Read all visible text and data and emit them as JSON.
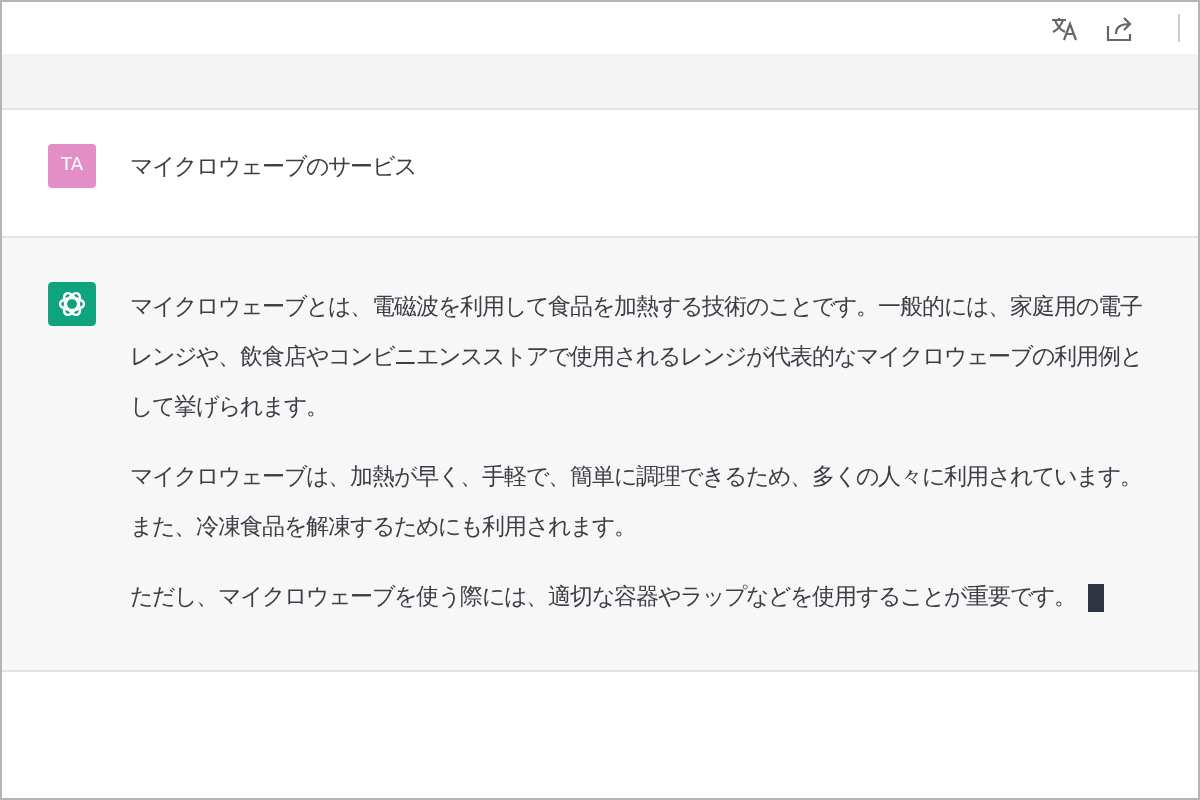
{
  "messages": [
    {
      "kind": "user",
      "avatar_text": "TA",
      "paragraphs": [
        "マイクロウェーブのサービス"
      ]
    },
    {
      "kind": "assistant",
      "paragraphs": [
        "マイクロウェーブとは、電磁波を利用して食品を加熱する技術のことです。一般的には、家庭用の電子レンジや、飲食店やコンビニエンスストアで使用されるレンジが代表的なマイクロウェーブの利用例として挙げられます。",
        "マイクロウェーブは、加熱が早く、手軽で、簡単に調理できるため、多くの人々に利用されています。また、冷凍食品を解凍するためにも利用されます。",
        "ただし、マイクロウェーブを使う際には、適切な容器やラップなどを使用することが重要です。"
      ],
      "cursor": true
    }
  ]
}
